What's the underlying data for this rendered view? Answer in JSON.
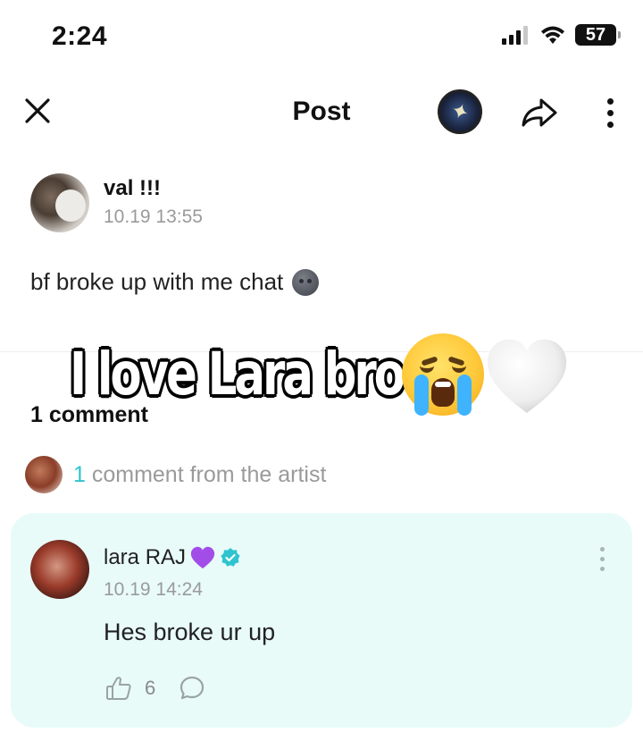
{
  "status_bar": {
    "time": "2:24",
    "battery": "57"
  },
  "header": {
    "title": "Post"
  },
  "post": {
    "author_name": "val !!!",
    "timestamp": "10.19 13:55",
    "text": "bf broke up with me chat"
  },
  "overlay": {
    "caption": "I love Lara bro"
  },
  "comments": {
    "count_label": "1 comment",
    "artist_count": "1",
    "artist_label": " comment from the artist",
    "items": [
      {
        "author": "lara RAJ",
        "timestamp": "10.19 14:24",
        "text": "Hes broke ur up",
        "likes": "6"
      }
    ]
  },
  "colors": {
    "accent": "#2ec4cf",
    "comment_bg": "#e8fbf9",
    "verified": "#2ec4cf",
    "purple_heart": "#a34de8"
  }
}
